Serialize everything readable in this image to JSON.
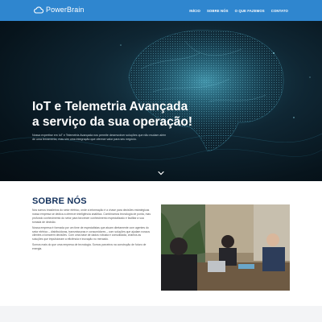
{
  "nav": {
    "brand": "PowerBrain",
    "items": [
      {
        "label": "INÍCIO"
      },
      {
        "label": "SOBRE NÓS"
      },
      {
        "label": "O QUE FAZEMOS"
      },
      {
        "label": "CONTATO"
      }
    ]
  },
  "hero": {
    "title": "IoT e Telemetria Avançada a serviço da sua operação!",
    "text": "Nossa expertise em IoT e Telemetria Avançada nos permite desenvolver soluções que não mudam além de uma ferramenta, mas sim uma integração que oferece valor para seu negócio."
  },
  "about": {
    "title": "SOBRE NÓS",
    "paragraphs": [
      "Nos somos brasileiros do setor elétrico, onde a informação é a chave para decisões estratégicas nossa empresa se dedica a oferecer inteligência analítica. Combinamos tecnologia de ponta, mas profundo conhecimento do setor para favorecer conhecimento especializado e facilitar a sua tomada de decisão.",
      "Nossa empresa é formada por um time de especialistas que atuam diretamente com agentes do setor elétrico – distribuidoras, transmissoras e consumidores – com soluções que ajudam nossos clientes a tomarem decisões. Com uma base de dados robusta e consolidada, criamos as soluções que impulsionam a eficiência e inovação no mercado.",
      "Somos mais do que uma empresa de tecnologia. Somos parceiros na construção de futuro de energia."
    ]
  },
  "colors": {
    "nav_bg": "#2f86cf",
    "hero_bg": "#07141c",
    "about_title": "#13315c",
    "accent_glow": "#43c7e6"
  },
  "icons": {
    "logo": "cloud-icon",
    "scroll": "chevron-down-icon"
  }
}
